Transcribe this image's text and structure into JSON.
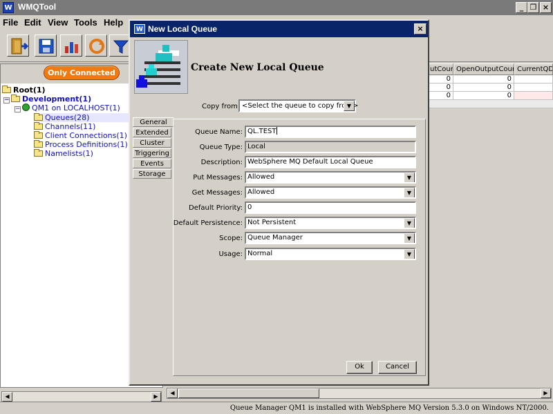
{
  "window": {
    "title": "WMQTool",
    "icon": "W",
    "controls": {
      "minimize": "_",
      "restore": "❐",
      "close": "×"
    }
  },
  "menubar": {
    "items": [
      "File",
      "Edit",
      "View",
      "Tools",
      "Help"
    ]
  },
  "toolbar": {
    "buttons": [
      "exit-icon",
      "save-icon",
      "chart-icon",
      "refresh-icon",
      "filter-icon"
    ]
  },
  "left_panel": {
    "filter_button": "Only Connected",
    "tree": {
      "root": "Root(1)",
      "development": "Development(1)",
      "qmgr": "QM1 on LOCALHOST(1)",
      "children": [
        "Queues(28)",
        "Channels(11)",
        "Client Connections(1)",
        "Process Definitions(1)",
        "Namelists(1)"
      ]
    }
  },
  "table": {
    "headers": [
      "utCount",
      "OpenOutputCount",
      "CurrentQDe"
    ],
    "rows": [
      [
        "0",
        "0",
        ""
      ],
      [
        "0",
        "0",
        ""
      ],
      [
        "0",
        "0",
        ""
      ]
    ]
  },
  "dialog": {
    "title": "New Local Queue",
    "icon": "W",
    "close": "×",
    "banner_title": "Create New Local Queue",
    "copy_from": {
      "label": "Copy from",
      "value": "<Select the queue to copy from>"
    },
    "tabs": [
      "General",
      "Extended",
      "Cluster",
      "Triggering",
      "Events",
      "Storage"
    ],
    "active_tab": "General",
    "fields": {
      "queue_name": {
        "label": "Queue Name:",
        "value": "QL.TEST"
      },
      "queue_type": {
        "label": "Queue Type:",
        "value": "Local"
      },
      "description": {
        "label": "Description:",
        "value": "WebSphere MQ Default Local Queue"
      },
      "put_messages": {
        "label": "Put Messages:",
        "value": "Allowed"
      },
      "get_messages": {
        "label": "Get Messages:",
        "value": "Allowed"
      },
      "default_priority": {
        "label": "Default Priority:",
        "value": "0"
      },
      "default_persistence": {
        "label": "Default Persistence:",
        "value": "Not Persistent"
      },
      "scope": {
        "label": "Scope:",
        "value": "Queue Manager"
      },
      "usage": {
        "label": "Usage:",
        "value": "Normal"
      }
    },
    "buttons": {
      "ok": "Ok",
      "cancel": "Cancel"
    }
  },
  "status_bar": {
    "text": "Queue Manager QM1 is installed with WebSphere MQ Version 5.3.0 on Windows NT/2000."
  }
}
